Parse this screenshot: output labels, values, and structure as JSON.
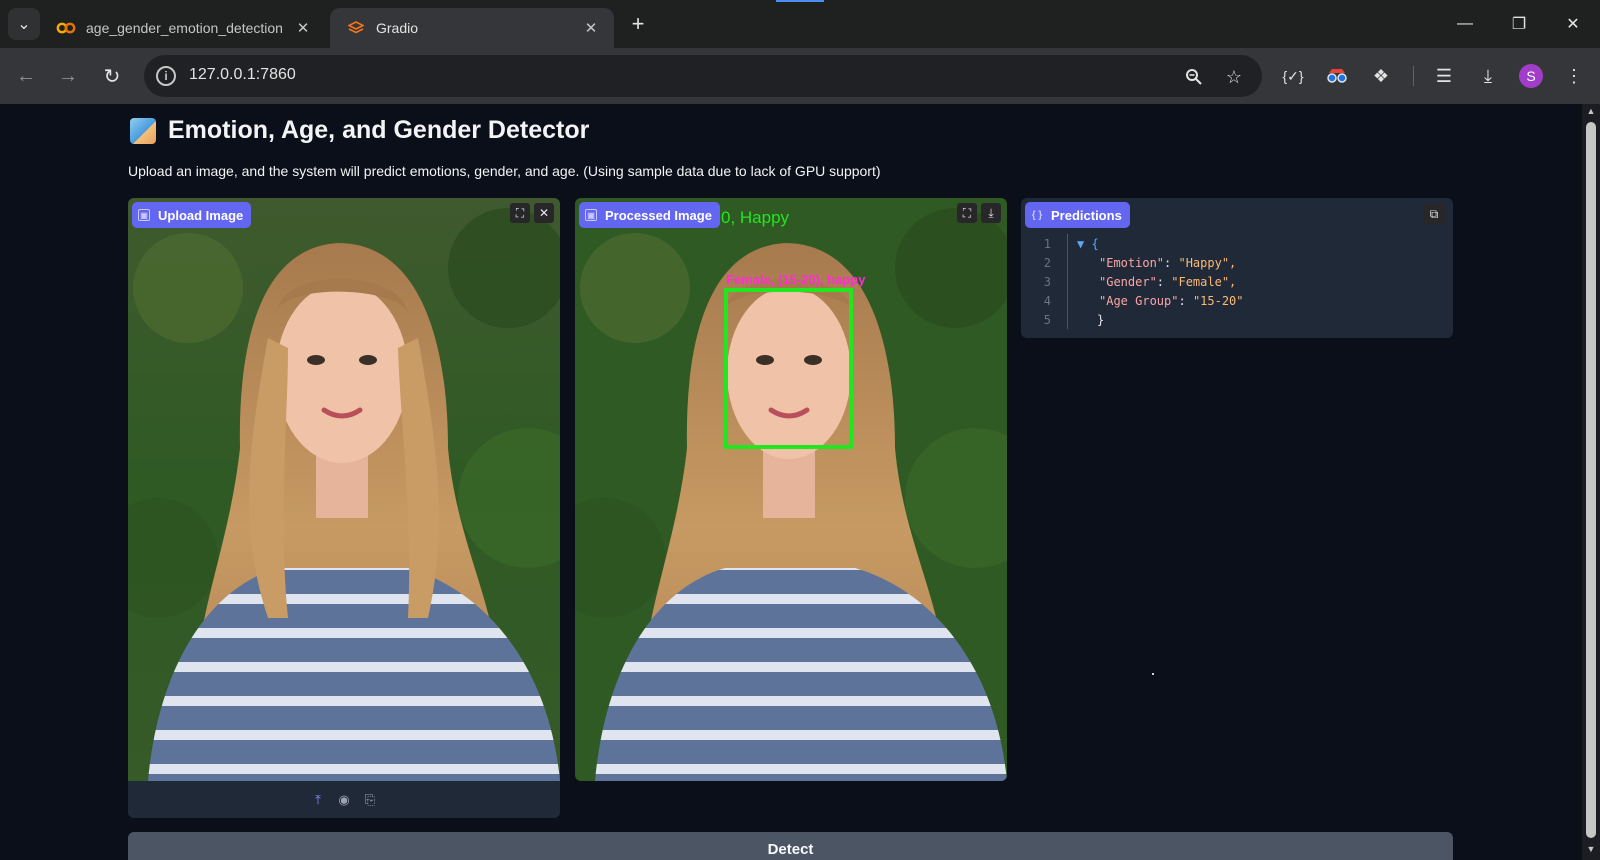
{
  "browser": {
    "tabs": [
      {
        "title": "age_gender_emotion_detection",
        "favicon": "colab-icon",
        "active": false
      },
      {
        "title": "Gradio",
        "favicon": "gradio-icon",
        "active": true
      }
    ],
    "url": "127.0.0.1:7860",
    "profile_initial": "S",
    "colors": {
      "tab_bar": "#1f2020",
      "toolbar": "#35363a",
      "omnibox": "#202124",
      "profile": "#a23dc9"
    }
  },
  "page": {
    "title": "Emotion, Age, and Gender Detector",
    "description": "Upload an image, and the system will predict emotions, gender, and age. (Using sample data due to lack of GPU support)",
    "upload_panel": {
      "label": "Upload Image"
    },
    "processed_panel": {
      "label": "Processed Image",
      "overlay_top_text": "0, Happy",
      "overlay_face_text": "Female, (15-20), happy"
    },
    "predictions_panel": {
      "label": "Predictions",
      "json_lines": [
        {
          "n": "1",
          "text": "▼ {"
        },
        {
          "n": "2",
          "key": "\"Emotion\"",
          "value": "\"Happy\","
        },
        {
          "n": "3",
          "key": "\"Gender\"",
          "value": "\"Female\","
        },
        {
          "n": "4",
          "key": "\"Age Group\"",
          "value": "\"15-20\""
        },
        {
          "n": "5",
          "text": "}"
        }
      ]
    },
    "detect_button": "Detect",
    "colors": {
      "background": "#0b0f19",
      "panel": "#1f2937",
      "accent": "#6366f1",
      "box": "#22e61f",
      "face_label": "#ff2bd6"
    }
  }
}
